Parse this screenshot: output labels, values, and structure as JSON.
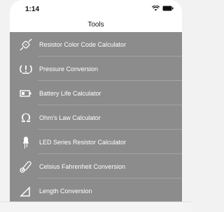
{
  "status": {
    "time": "1:14"
  },
  "nav": {
    "title": "Tools"
  },
  "tools": [
    {
      "label": "Resistor Color Code Calculator",
      "icon": "resistor-icon"
    },
    {
      "label": "Pressure Conversion",
      "icon": "pressure-warning-icon"
    },
    {
      "label": "Battery Life Calculator",
      "icon": "battery-icon"
    },
    {
      "label": "Ohm's Law Calculator",
      "icon": "omega-icon"
    },
    {
      "label": "LED Series Resistor Calculator",
      "icon": "led-icon"
    },
    {
      "label": "Celsius Fahrenheit Conversion",
      "icon": "thermometer-icon"
    },
    {
      "label": "Length Conversion",
      "icon": "ruler-icon"
    }
  ],
  "colors": {
    "list_bg": "#8c8c8c",
    "text": "#ffffff"
  }
}
